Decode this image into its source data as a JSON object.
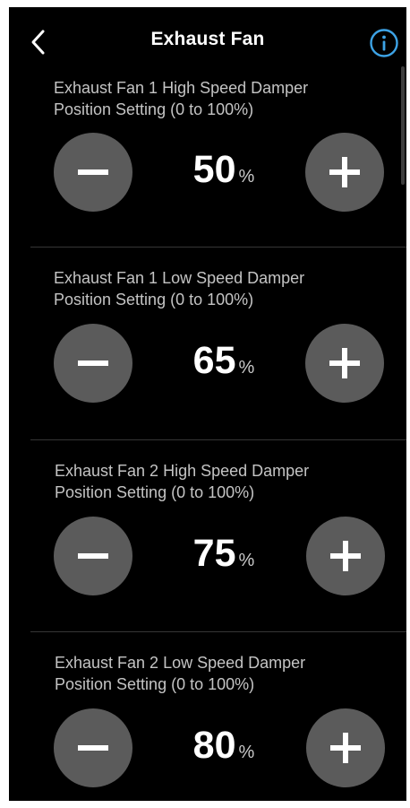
{
  "header": {
    "title": "Exhaust Fan",
    "back_icon": "chevron-left-icon",
    "info_icon": "info-icon",
    "info_color": "#3da3e6"
  },
  "settings": [
    {
      "label_line1": "Exhaust Fan 1 High Speed Damper",
      "label_line2": "Position Setting (0 to 100%)",
      "value": "50",
      "unit": "%"
    },
    {
      "label_line1": "Exhaust Fan 1 Low Speed Damper",
      "label_line2": "Position Setting (0 to 100%)",
      "value": "65",
      "unit": "%"
    },
    {
      "label_line1": "Exhaust Fan 2 High Speed Damper",
      "label_line2": "Position Setting (0 to 100%)",
      "value": "75",
      "unit": "%"
    },
    {
      "label_line1": "Exhaust Fan 2 Low Speed Damper",
      "label_line2": "Position Setting (0 to 100%)",
      "value": "80",
      "unit": "%"
    }
  ],
  "colors": {
    "background": "#000000",
    "button": "#5b5b5b",
    "label_text": "#c4c4c4",
    "value_text": "#ffffff",
    "divider": "#353535"
  }
}
